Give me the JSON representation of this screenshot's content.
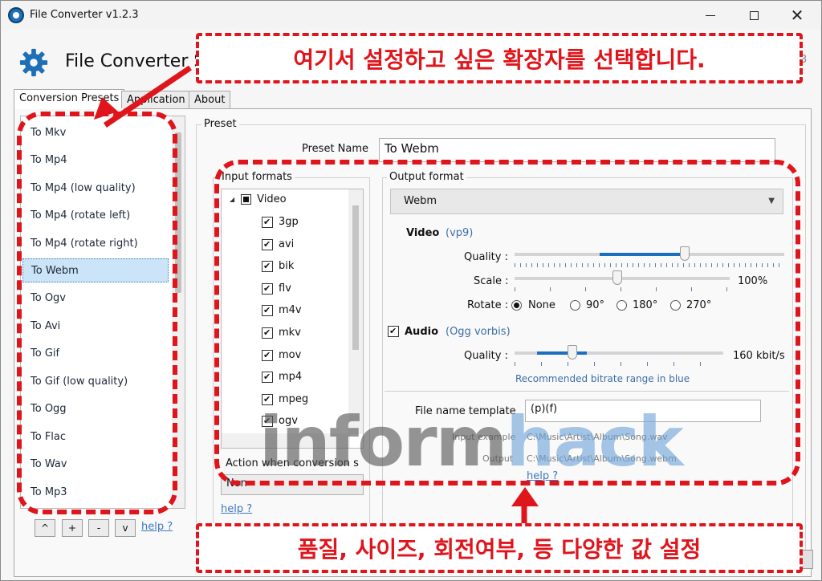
{
  "window": {
    "title": "File Converter v1.2.3"
  },
  "header": {
    "title": "File Converter S",
    "version_fragment": "3"
  },
  "tabs": [
    {
      "label": "Conversion Presets",
      "active": true
    },
    {
      "label": "Application"
    },
    {
      "label": "About"
    }
  ],
  "presets": {
    "items": [
      "To Mkv",
      "To Mp4",
      "To Mp4 (low quality)",
      "To Mp4 (rotate left)",
      "To Mp4 (rotate right)",
      "To Webm",
      "To Ogv",
      "To Avi",
      "To Gif",
      "To Gif (low quality)",
      "To Ogg",
      "To Flac",
      "To Wav",
      "To Mp3"
    ],
    "selected_index": 5,
    "buttons": [
      "^",
      "+",
      "-",
      "v"
    ],
    "help_label": "help ?"
  },
  "preset": {
    "group_title": "Preset",
    "name_label": "Preset Name",
    "name_value": "To Webm",
    "input_formats": {
      "title": "Input formats",
      "group_label": "Video",
      "items": [
        "3gp",
        "avi",
        "bik",
        "flv",
        "m4v",
        "mkv",
        "mov",
        "mp4",
        "mpeg",
        "ogv"
      ]
    },
    "action_label": "Action when conversion s",
    "action_value": "Non",
    "help_label": "help ?",
    "output": {
      "title": "Output format",
      "format": "Webm",
      "video": {
        "label": "Video",
        "codec": "(vp9)",
        "quality_label": "Quality :",
        "quality_level": 0.63,
        "scale_label": "Scale :",
        "scale_value": "100%",
        "rotate_label": "Rotate :",
        "rotate_options": [
          "None",
          "90°",
          "180°",
          "270°"
        ],
        "rotate_selected": 0
      },
      "audio": {
        "label": "Audio",
        "codec": "(Ogg vorbis)",
        "enabled": true,
        "quality_label": "Quality :",
        "quality_value": "160 kbit/s",
        "recommended_note": "Recommended bitrate range in blue"
      },
      "file_name_template_label": "File name template",
      "file_name_template_value": "(p)(f)",
      "input_example_label": "Input example",
      "input_example_value": "C:\\Music\\Artist\\Album\\Song.wav",
      "output_label": "Output",
      "output_value": "C:\\Music\\Artist\\Album\\Song.webm",
      "help_label": "help ?"
    }
  },
  "annotations": {
    "top_callout": "여기서 설정하고 싶은 확장자를 선택합니다.",
    "bottom_callout": "품질, 사이즈, 회전여부, 등 다양한 값 설정",
    "color": "#e0141b"
  },
  "watermark": {
    "part1": "inform",
    "part2": "hack"
  }
}
